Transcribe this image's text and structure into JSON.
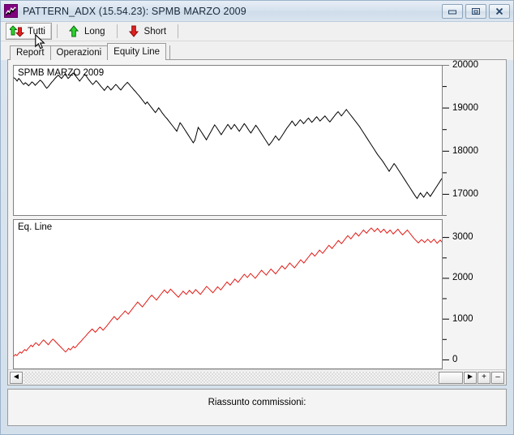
{
  "window": {
    "title": "PATTERN_ADX (15.54.23): SPMB MARZO 2009",
    "icon_name": "chart-line-icon",
    "buttons": {
      "minimize": "minimize-icon",
      "restore": "restore-icon",
      "close": "close-icon"
    }
  },
  "toolbar": {
    "items": [
      {
        "label": "Tutti",
        "icon": "up-down-arrows-icon",
        "active": true
      },
      {
        "label": "Long",
        "icon": "green-up-arrow-icon",
        "active": false
      },
      {
        "label": "Short",
        "icon": "red-down-arrow-icon",
        "active": false
      }
    ]
  },
  "tabs": [
    {
      "label": "Report",
      "selected": false
    },
    {
      "label": "Operazioni",
      "selected": false
    },
    {
      "label": "Equity Line",
      "selected": true
    }
  ],
  "scrollbar": {
    "left_arrow": "◄",
    "right_arrow": "►",
    "zoom_in": "+",
    "zoom_out": "–"
  },
  "status": {
    "text": "Riassunto commissioni:"
  },
  "colors": {
    "price_line": "#000000",
    "equity_line": "#e01b16",
    "plot_background": "#ffffff",
    "plot_border": "#808080",
    "window_chrome": "#f0f0f0",
    "title_text": "#1a2a3a",
    "icon_purple": "#800080",
    "arrow_green": "#00a000",
    "arrow_red": "#d01010"
  },
  "chart_data": [
    {
      "type": "line",
      "name": "price-chart",
      "title": "SPMB MARZO 2009",
      "xlabel": "",
      "ylabel": "",
      "ylim": [
        16500,
        20000
      ],
      "yticks": [
        17000,
        18000,
        19000,
        20000
      ],
      "ytick_labels": [
        "17000",
        "18000",
        "19000",
        "20000"
      ],
      "minor_tick_step": 500,
      "grid": false,
      "legend": "none",
      "line_color": "#000000",
      "x": [
        0,
        1,
        2,
        3,
        4,
        5,
        6,
        7,
        8,
        9,
        10,
        11,
        12,
        13,
        14,
        15,
        16,
        17,
        18,
        19,
        20,
        21,
        22,
        23,
        24,
        25,
        26,
        27,
        28,
        29,
        30,
        31,
        32,
        33,
        34,
        35,
        36,
        37,
        38,
        39,
        40,
        41,
        42,
        43,
        44,
        45,
        46,
        47,
        48,
        49,
        50,
        51,
        52,
        53,
        54,
        55,
        56,
        57,
        58,
        59,
        60,
        61,
        62,
        63,
        64,
        65,
        66,
        67,
        68,
        69,
        70,
        71,
        72,
        73,
        74,
        75,
        76,
        77,
        78,
        79,
        80,
        81,
        82,
        83,
        84,
        85,
        86,
        87,
        88,
        89,
        90,
        91,
        92,
        93,
        94,
        95,
        96,
        97,
        98,
        99,
        100,
        101,
        102,
        103,
        104,
        105,
        106,
        107,
        108,
        109,
        110,
        111,
        112,
        113,
        114,
        115,
        116,
        117,
        118,
        119,
        120,
        121,
        122,
        123,
        124,
        125,
        126,
        127,
        128,
        129,
        130,
        131,
        132,
        133,
        134,
        135,
        136,
        137,
        138,
        139,
        140,
        141,
        142,
        143,
        144,
        145,
        146,
        147,
        148,
        149,
        150,
        151,
        152,
        153,
        154,
        155,
        156,
        157,
        158,
        159,
        160,
        161,
        162,
        163,
        164,
        165,
        166,
        167,
        168,
        169,
        170,
        171,
        172,
        173,
        174,
        175,
        176,
        177,
        178,
        179,
        180,
        181,
        182,
        183,
        184,
        185,
        186,
        187,
        188,
        189,
        190,
        191,
        192,
        193,
        194,
        195,
        196,
        197,
        198,
        199,
        200,
        201,
        202,
        203,
        204,
        205,
        206,
        207,
        208,
        209,
        210,
        211,
        212,
        213,
        214,
        215,
        216,
        217,
        218,
        219,
        220,
        221,
        222,
        223,
        224,
        225,
        226,
        227,
        228,
        229,
        230,
        231,
        232,
        233,
        234,
        235,
        236,
        237,
        238,
        239,
        240,
        241,
        242,
        243,
        244,
        245,
        246,
        247,
        248,
        249,
        250,
        251,
        252,
        253,
        254,
        255,
        256,
        257,
        258,
        259,
        260,
        261,
        262,
        263,
        264,
        265,
        266,
        267,
        268,
        269
      ],
      "values": [
        19720,
        19690,
        19640,
        19700,
        19660,
        19600,
        19560,
        19600,
        19570,
        19530,
        19570,
        19620,
        19590,
        19540,
        19580,
        19620,
        19660,
        19630,
        19580,
        19520,
        19470,
        19510,
        19560,
        19610,
        19650,
        19700,
        19740,
        19780,
        19740,
        19700,
        19750,
        19800,
        19760,
        19700,
        19740,
        19790,
        19830,
        19790,
        19740,
        19690,
        19640,
        19690,
        19740,
        19800,
        19760,
        19700,
        19650,
        19600,
        19560,
        19600,
        19650,
        19610,
        19560,
        19510,
        19470,
        19420,
        19470,
        19520,
        19480,
        19430,
        19470,
        19520,
        19560,
        19520,
        19470,
        19430,
        19480,
        19530,
        19570,
        19610,
        19570,
        19520,
        19480,
        19430,
        19390,
        19340,
        19300,
        19250,
        19200,
        19150,
        19100,
        19150,
        19100,
        19050,
        19000,
        18950,
        18900,
        18950,
        19010,
        18960,
        18900,
        18850,
        18800,
        18760,
        18710,
        18660,
        18610,
        18560,
        18510,
        18460,
        18560,
        18660,
        18610,
        18550,
        18490,
        18430,
        18370,
        18310,
        18250,
        18190,
        18250,
        18400,
        18550,
        18500,
        18440,
        18380,
        18320,
        18260,
        18330,
        18400,
        18470,
        18540,
        18610,
        18560,
        18500,
        18440,
        18380,
        18440,
        18500,
        18560,
        18620,
        18570,
        18510,
        18560,
        18620,
        18570,
        18510,
        18460,
        18520,
        18580,
        18640,
        18590,
        18530,
        18470,
        18420,
        18480,
        18540,
        18600,
        18550,
        18490,
        18430,
        18370,
        18310,
        18250,
        18190,
        18130,
        18180,
        18230,
        18290,
        18350,
        18300,
        18250,
        18300,
        18360,
        18420,
        18480,
        18540,
        18590,
        18640,
        18700,
        18650,
        18590,
        18630,
        18680,
        18730,
        18690,
        18640,
        18680,
        18730,
        18770,
        18720,
        18670,
        18710,
        18760,
        18800,
        18750,
        18700,
        18740,
        18780,
        18820,
        18770,
        18720,
        18680,
        18730,
        18780,
        18830,
        18880,
        18920,
        18870,
        18820,
        18870,
        18920,
        18970,
        18920,
        18870,
        18820,
        18770,
        18720,
        18670,
        18620,
        18570,
        18510,
        18450,
        18390,
        18330,
        18270,
        18210,
        18150,
        18090,
        18030,
        17970,
        17910,
        17860,
        17810,
        17760,
        17700,
        17640,
        17580,
        17520,
        17580,
        17640,
        17700,
        17650,
        17590,
        17530,
        17470,
        17410,
        17350,
        17290,
        17230,
        17170,
        17110,
        17050,
        16990,
        16930,
        16880,
        16950,
        17010,
        16960,
        16910,
        16970,
        17030,
        16980,
        16930,
        16990,
        17050,
        17110,
        17170,
        17230,
        17290,
        17350
      ]
    },
    {
      "type": "line",
      "name": "equity-line-chart",
      "title": "Eq. Line",
      "xlabel": "",
      "ylabel": "",
      "ylim": [
        -250,
        3450
      ],
      "yticks": [
        0,
        1000,
        2000,
        3000
      ],
      "ytick_labels": [
        "0",
        "1000",
        "2000",
        "3000"
      ],
      "minor_tick_step": 500,
      "grid": false,
      "legend": "none",
      "line_color": "#e01b16",
      "x": [
        0,
        1,
        2,
        3,
        4,
        5,
        6,
        7,
        8,
        9,
        10,
        11,
        12,
        13,
        14,
        15,
        16,
        17,
        18,
        19,
        20,
        21,
        22,
        23,
        24,
        25,
        26,
        27,
        28,
        29,
        30,
        31,
        32,
        33,
        34,
        35,
        36,
        37,
        38,
        39,
        40,
        41,
        42,
        43,
        44,
        45,
        46,
        47,
        48,
        49,
        50,
        51,
        52,
        53,
        54,
        55,
        56,
        57,
        58,
        59,
        60,
        61,
        62,
        63,
        64,
        65,
        66,
        67,
        68,
        69,
        70,
        71,
        72,
        73,
        74,
        75,
        76,
        77,
        78,
        79,
        80,
        81,
        82,
        83,
        84,
        85,
        86,
        87,
        88,
        89,
        90,
        91,
        92,
        93,
        94,
        95,
        96,
        97,
        98,
        99,
        100,
        101,
        102,
        103,
        104,
        105,
        106,
        107,
        108,
        109,
        110,
        111,
        112,
        113,
        114,
        115,
        116,
        117,
        118,
        119,
        120,
        121,
        122,
        123,
        124,
        125,
        126,
        127,
        128,
        129,
        130,
        131,
        132,
        133,
        134,
        135,
        136,
        137,
        138,
        139,
        140,
        141,
        142,
        143,
        144,
        145,
        146,
        147,
        148,
        149,
        150,
        151,
        152,
        153,
        154,
        155,
        156,
        157,
        158,
        159,
        160,
        161,
        162,
        163,
        164,
        165,
        166,
        167,
        168,
        169,
        170,
        171,
        172,
        173,
        174,
        175,
        176,
        177,
        178,
        179,
        180,
        181,
        182,
        183,
        184,
        185,
        186,
        187,
        188,
        189,
        190,
        191,
        192,
        193,
        194,
        195,
        196,
        197,
        198,
        199,
        200,
        201,
        202,
        203,
        204,
        205,
        206,
        207,
        208,
        209,
        210,
        211,
        212,
        213,
        214,
        215,
        216,
        217,
        218,
        219,
        220,
        221,
        222,
        223,
        224,
        225,
        226,
        227,
        228,
        229,
        230,
        231,
        232,
        233,
        234,
        235,
        236,
        237,
        238,
        239,
        240,
        241,
        242,
        243,
        244,
        245,
        246,
        247,
        248,
        249,
        250,
        251,
        252,
        253,
        254,
        255,
        256,
        257,
        258,
        259,
        260,
        261,
        262,
        263,
        264,
        265,
        266,
        267,
        268,
        269
      ],
      "values": [
        60,
        110,
        80,
        130,
        170,
        140,
        190,
        230,
        200,
        250,
        290,
        340,
        300,
        350,
        400,
        370,
        330,
        380,
        430,
        470,
        430,
        390,
        350,
        400,
        450,
        490,
        450,
        410,
        370,
        330,
        290,
        250,
        210,
        170,
        210,
        260,
        220,
        260,
        310,
        270,
        310,
        360,
        400,
        440,
        490,
        530,
        570,
        620,
        660,
        700,
        740,
        700,
        660,
        700,
        750,
        790,
        750,
        710,
        760,
        800,
        850,
        900,
        950,
        1000,
        1050,
        1010,
        970,
        1010,
        1060,
        1100,
        1140,
        1190,
        1150,
        1110,
        1160,
        1210,
        1260,
        1310,
        1360,
        1410,
        1370,
        1330,
        1290,
        1340,
        1390,
        1440,
        1490,
        1540,
        1580,
        1540,
        1500,
        1460,
        1510,
        1560,
        1610,
        1660,
        1710,
        1670,
        1630,
        1680,
        1730,
        1690,
        1650,
        1610,
        1570,
        1530,
        1580,
        1630,
        1680,
        1640,
        1600,
        1650,
        1700,
        1660,
        1620,
        1670,
        1720,
        1680,
        1640,
        1600,
        1650,
        1700,
        1750,
        1800,
        1760,
        1720,
        1680,
        1640,
        1690,
        1740,
        1790,
        1750,
        1710,
        1760,
        1810,
        1860,
        1910,
        1870,
        1830,
        1880,
        1930,
        1980,
        1940,
        1900,
        1950,
        2000,
        2050,
        2100,
        2060,
        2020,
        2070,
        2120,
        2080,
        2040,
        2000,
        2050,
        2100,
        2150,
        2200,
        2160,
        2120,
        2080,
        2130,
        2180,
        2230,
        2190,
        2150,
        2110,
        2160,
        2210,
        2260,
        2310,
        2270,
        2230,
        2280,
        2330,
        2380,
        2340,
        2300,
        2260,
        2310,
        2360,
        2410,
        2460,
        2420,
        2380,
        2430,
        2480,
        2530,
        2580,
        2630,
        2590,
        2550,
        2600,
        2650,
        2700,
        2660,
        2620,
        2670,
        2720,
        2770,
        2820,
        2780,
        2740,
        2790,
        2840,
        2890,
        2940,
        2900,
        2860,
        2910,
        2960,
        3010,
        3060,
        3020,
        2980,
        3030,
        3080,
        3130,
        3090,
        3050,
        3100,
        3150,
        3200,
        3160,
        3120,
        3170,
        3210,
        3250,
        3210,
        3160,
        3200,
        3240,
        3190,
        3140,
        3180,
        3220,
        3170,
        3120,
        3160,
        3200,
        3150,
        3100,
        3140,
        3180,
        3220,
        3170,
        3120,
        3080,
        3120,
        3160,
        3200,
        3150,
        3100,
        3050,
        3000,
        2960,
        2920,
        2880,
        2920,
        2960,
        2930,
        2890,
        2930,
        2970,
        2930,
        2890,
        2930,
        2970,
        2920,
        2870,
        2910,
        2950,
        2900
      ]
    }
  ]
}
